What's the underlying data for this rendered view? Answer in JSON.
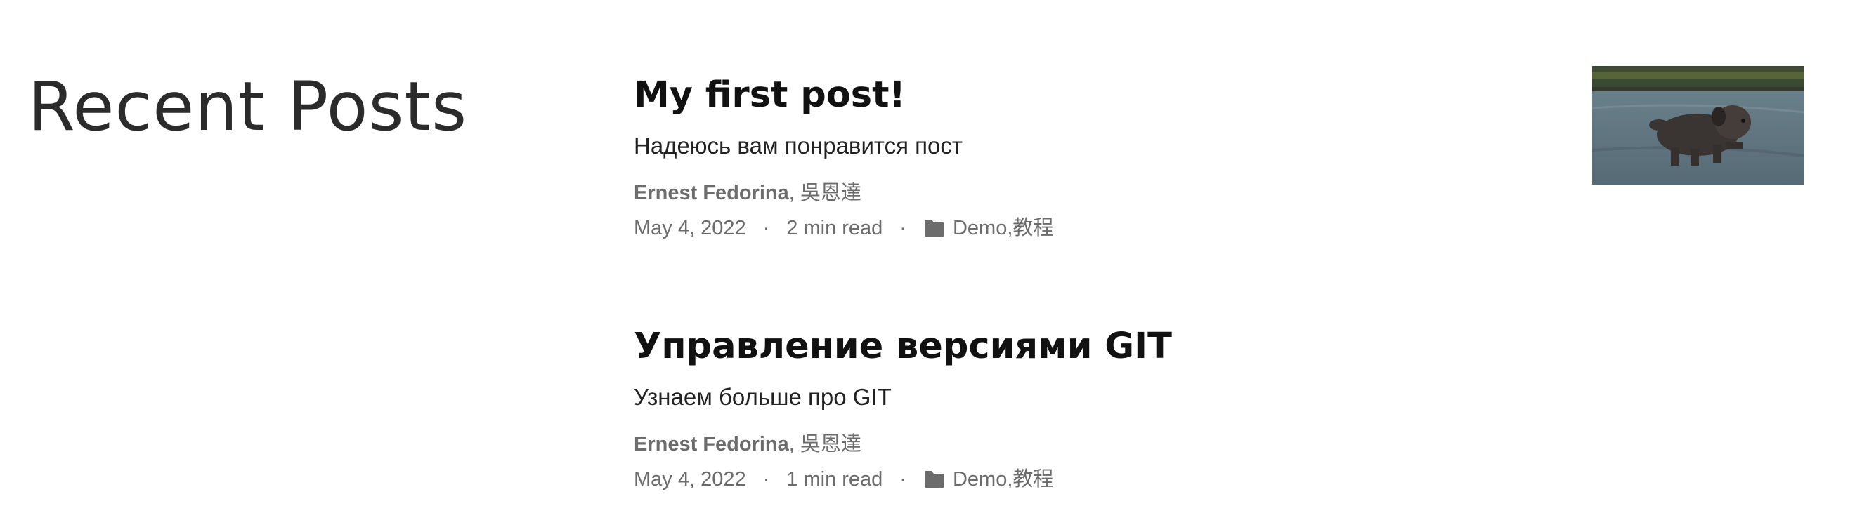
{
  "section": {
    "title": "Recent Posts"
  },
  "posts": [
    {
      "title": "My first post!",
      "summary": "Надеюсь вам понравится пост",
      "author_primary": "Ernest Fedorina",
      "author_separator": ", ",
      "author_secondary": "吳恩達",
      "date": "May 4, 2022",
      "separator": "·",
      "reading_time": "2 min read",
      "category_1": "Demo",
      "category_separator": ", ",
      "category_2": "教程",
      "has_thumbnail": true
    },
    {
      "title": "Управление версиями GIT",
      "summary": "Узнаем больше про GIT",
      "author_primary": "Ernest Fedorina",
      "author_separator": ", ",
      "author_secondary": "吳恩達",
      "date": "May 4, 2022",
      "separator": "·",
      "reading_time": "1 min read",
      "category_1": "Demo",
      "category_separator": ", ",
      "category_2": "教程",
      "has_thumbnail": false
    }
  ],
  "icons": {
    "category": "folder-icon"
  },
  "colors": {
    "title": "#111111",
    "meta": "#6c6c6c",
    "section_title": "#2b2b2b"
  }
}
